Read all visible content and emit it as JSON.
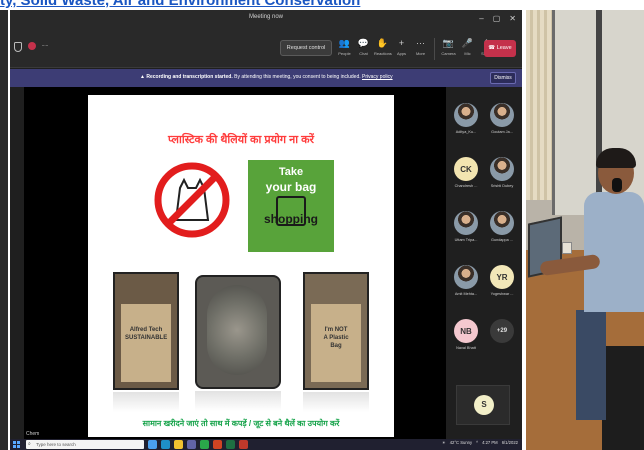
{
  "doc_link": "ty, Solid Waste, Air and Environment Conservation",
  "teams": {
    "window_title": "Meeting now",
    "window_controls": [
      "–",
      "▢",
      "✕"
    ],
    "request_control_label": "Request control",
    "toolbar_items": [
      {
        "icon": "people-icon",
        "glyph": "👥",
        "label": "People"
      },
      {
        "icon": "chat-icon",
        "glyph": "💬",
        "label": "Chat"
      },
      {
        "icon": "reactions-icon",
        "glyph": "✋",
        "label": "Reactions"
      },
      {
        "icon": "apps-icon",
        "glyph": "+",
        "label": "Apps"
      },
      {
        "icon": "more-icon",
        "glyph": "···",
        "label": "More"
      },
      {
        "icon": "camera-icon",
        "glyph": "📷",
        "label": "Camera"
      },
      {
        "icon": "mic-icon",
        "glyph": "🎤",
        "label": "Mic"
      },
      {
        "icon": "share-icon",
        "glyph": "⬆",
        "label": "Share"
      }
    ],
    "leave_label": "Leave",
    "banner": {
      "bold_text": "Recording and transcription started.",
      "text": " By attending this meeting, you consent to being included.",
      "link_text": "Privacy policy",
      "dismiss_label": "Dismiss"
    },
    "slide": {
      "title": "प्लास्टिक की थैलियों का प्रयोग ना करें",
      "bag_text_1": "Take",
      "bag_text_2": "your bag",
      "bag_text_3": "shopping",
      "photo1_label": "Alfred Tech\nSUSTAINABLE",
      "photo3_label": "I'm NOT\nA Plastic\nBag",
      "footer": "सामान खरीदने जाएं तो साथ में कपड़ें / जूट से बने थैलें का उपयोग करें"
    },
    "stage_label": "Chem",
    "participants": [
      {
        "name": "Aditya_Ku...",
        "initials": "",
        "avatar": "photo"
      },
      {
        "name": "Goutam Ja...",
        "initials": "",
        "avatar": "photo"
      },
      {
        "name": "Chandresh ...",
        "initials": "CK",
        "avatar": "initials",
        "color": "#f2e4b0"
      },
      {
        "name": "Srishti Dubey",
        "initials": "",
        "avatar": "photo"
      },
      {
        "name": "Uttam Tripa...",
        "initials": "",
        "avatar": "photo"
      },
      {
        "name": "Gundappa ...",
        "initials": "",
        "avatar": "photo"
      },
      {
        "name": "Amit Mehta...",
        "initials": "",
        "avatar": "photo"
      },
      {
        "name": "Yogeshwar ...",
        "initials": "YR",
        "avatar": "initials",
        "color": "#f2e7b8"
      },
      {
        "name": "Naval Bhatt",
        "initials": "NB",
        "avatar": "initials",
        "color": "#f4c8cf"
      },
      {
        "name": "",
        "initials": "+29",
        "avatar": "more",
        "color": "#3a3a3a"
      }
    ],
    "self_initial": "S",
    "taskbar": {
      "search_placeholder": "Type here to search",
      "weather": "42°C  Sunny",
      "time": "4:27 PM",
      "date": "6/1/2022"
    }
  },
  "colors": {
    "accent": "#c4314b",
    "banner": "#3d3d75",
    "slide_title": "#ff3b3b",
    "slide_footer": "#16a34a",
    "bag_green": "#58a33a"
  }
}
